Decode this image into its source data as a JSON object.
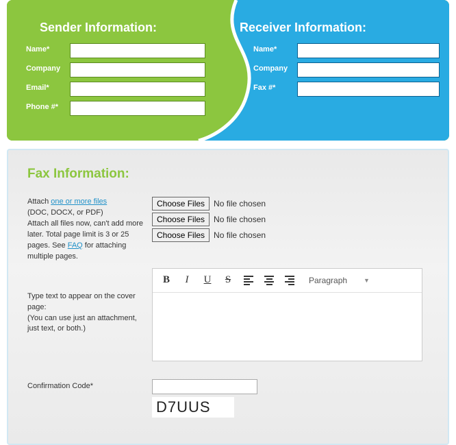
{
  "sender": {
    "heading": "Sender Information:",
    "fields": {
      "name": {
        "label": "Name*",
        "value": ""
      },
      "company": {
        "label": "Company",
        "value": ""
      },
      "email": {
        "label": "Email*",
        "value": ""
      },
      "phone": {
        "label": "Phone #*",
        "value": ""
      }
    }
  },
  "receiver": {
    "heading": "Receiver Information:",
    "fields": {
      "name": {
        "label": "Name*",
        "value": ""
      },
      "company": {
        "label": "Company",
        "value": ""
      },
      "fax": {
        "label": "Fax #*",
        "value": ""
      }
    }
  },
  "fax": {
    "heading": "Fax Information:",
    "attach_prefix": "Attach ",
    "attach_link": "one or more files",
    "attach_suffix1": "(DOC, DOCX, or PDF)",
    "attach_suffix2a": "Attach all files now, can't add more later. Total page limit is 3 or 25 pages. See ",
    "faq_link": "FAQ",
    "attach_suffix2b": " for attaching multiple pages.",
    "choose_label": "Choose Files",
    "no_file": "No file chosen",
    "cover_label1": "Type text to appear on the cover page:",
    "cover_label2": "(You can use just an attachment, just text, or both.)",
    "toolbar": {
      "bold": "B",
      "italic": "I",
      "underline": "U",
      "strike": "S",
      "paragraph": "Paragraph"
    },
    "cover_text": "",
    "confirmation_label": "Confirmation Code*",
    "confirmation_value": "",
    "captcha": "D7UUS"
  },
  "colors": {
    "green": "#8cc63f",
    "blue": "#29abe2"
  }
}
